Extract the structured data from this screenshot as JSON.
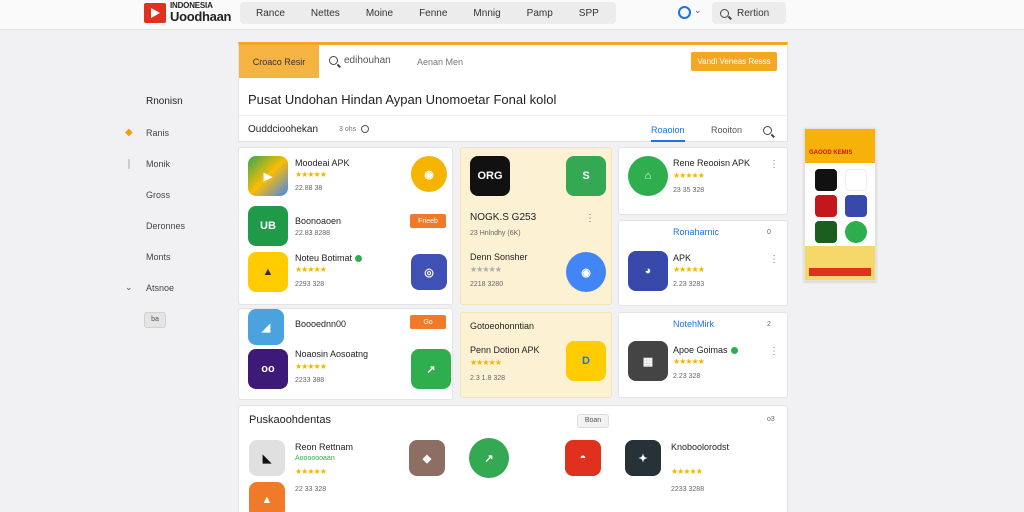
{
  "header": {
    "logo_line1": "INDONESIA",
    "logo_line2": "Uoodhaan",
    "nav": [
      "Rance",
      "Nettes",
      "Moine",
      "Fenne",
      "Mnnig",
      "Pamp",
      "SPP"
    ],
    "search_label": "Rertion"
  },
  "sidebar": {
    "title": "Rnonisn",
    "items": [
      "Ranis",
      "Monik",
      "Gross",
      "Deronnes",
      "Monts",
      "Atsnoe"
    ],
    "button_label": "ba"
  },
  "main": {
    "category_button": "Croaco Resir",
    "search_text": "edihouhan",
    "search_placeholder": "Aenan Men",
    "cta_button": "Vandi Veneas Resss",
    "hero_title": "Pusat Undohan Hindan Aypan Unomoetar Fonal kolol",
    "section_title": "Ouddcioohekan",
    "section_count": "3 ohs",
    "tab_active": "Roaoion",
    "tab_other": "Rooiton"
  },
  "cards": {
    "col1": [
      {
        "name": "Moodeai APK",
        "meta": "22.88 38"
      },
      {
        "name": "Boonoaoen",
        "meta": "22.83 8288"
      },
      {
        "name": "Noteu Botimat",
        "meta": "2293 328"
      },
      {
        "name": "Boooednn00",
        "meta": ""
      },
      {
        "name": "Noaosin Aosoatng",
        "meta": "2233 388"
      }
    ],
    "col1_pill": "Frieeb",
    "col2_top": {
      "logo_text": "ORG",
      "name": "NOGK.S G253",
      "meta": "23 Hnlndhy (6K)",
      "name2": "Denn Sonsher",
      "meta2": "2218 3280"
    },
    "col2_bottom": {
      "section": "Gotoeohonntian",
      "name": "Penn Dotion APK",
      "meta": "2.3 1.8 328"
    },
    "col3": [
      {
        "name": "Rene Reooisn APK",
        "meta": "23 35 328"
      },
      {
        "section": "Ronaharnic",
        "name": "APK",
        "meta": "2.23 3283"
      },
      {
        "section": "NotehMirk",
        "name": "Apoe Goimas",
        "meta": "2.23 328"
      }
    ],
    "col3_counts": [
      "0",
      "2"
    ]
  },
  "ad": {
    "title": "GAOOD KEMIS",
    "colors": [
      "#f6b10a",
      "#c4171c",
      "#e0301e"
    ]
  },
  "bottom": {
    "title": "Puskaoohdentas",
    "filter": "Boan",
    "count": "o3",
    "items": [
      {
        "name": "Reon Rettnam",
        "meta": "Aooooooaan",
        "meta2": "22 33 328"
      },
      {
        "name": "Knoboolorodst",
        "meta": "2233 3288"
      }
    ]
  },
  "colors": {
    "accent": "#f5a623",
    "link": "#1a73e8",
    "star": "#f4b400"
  }
}
